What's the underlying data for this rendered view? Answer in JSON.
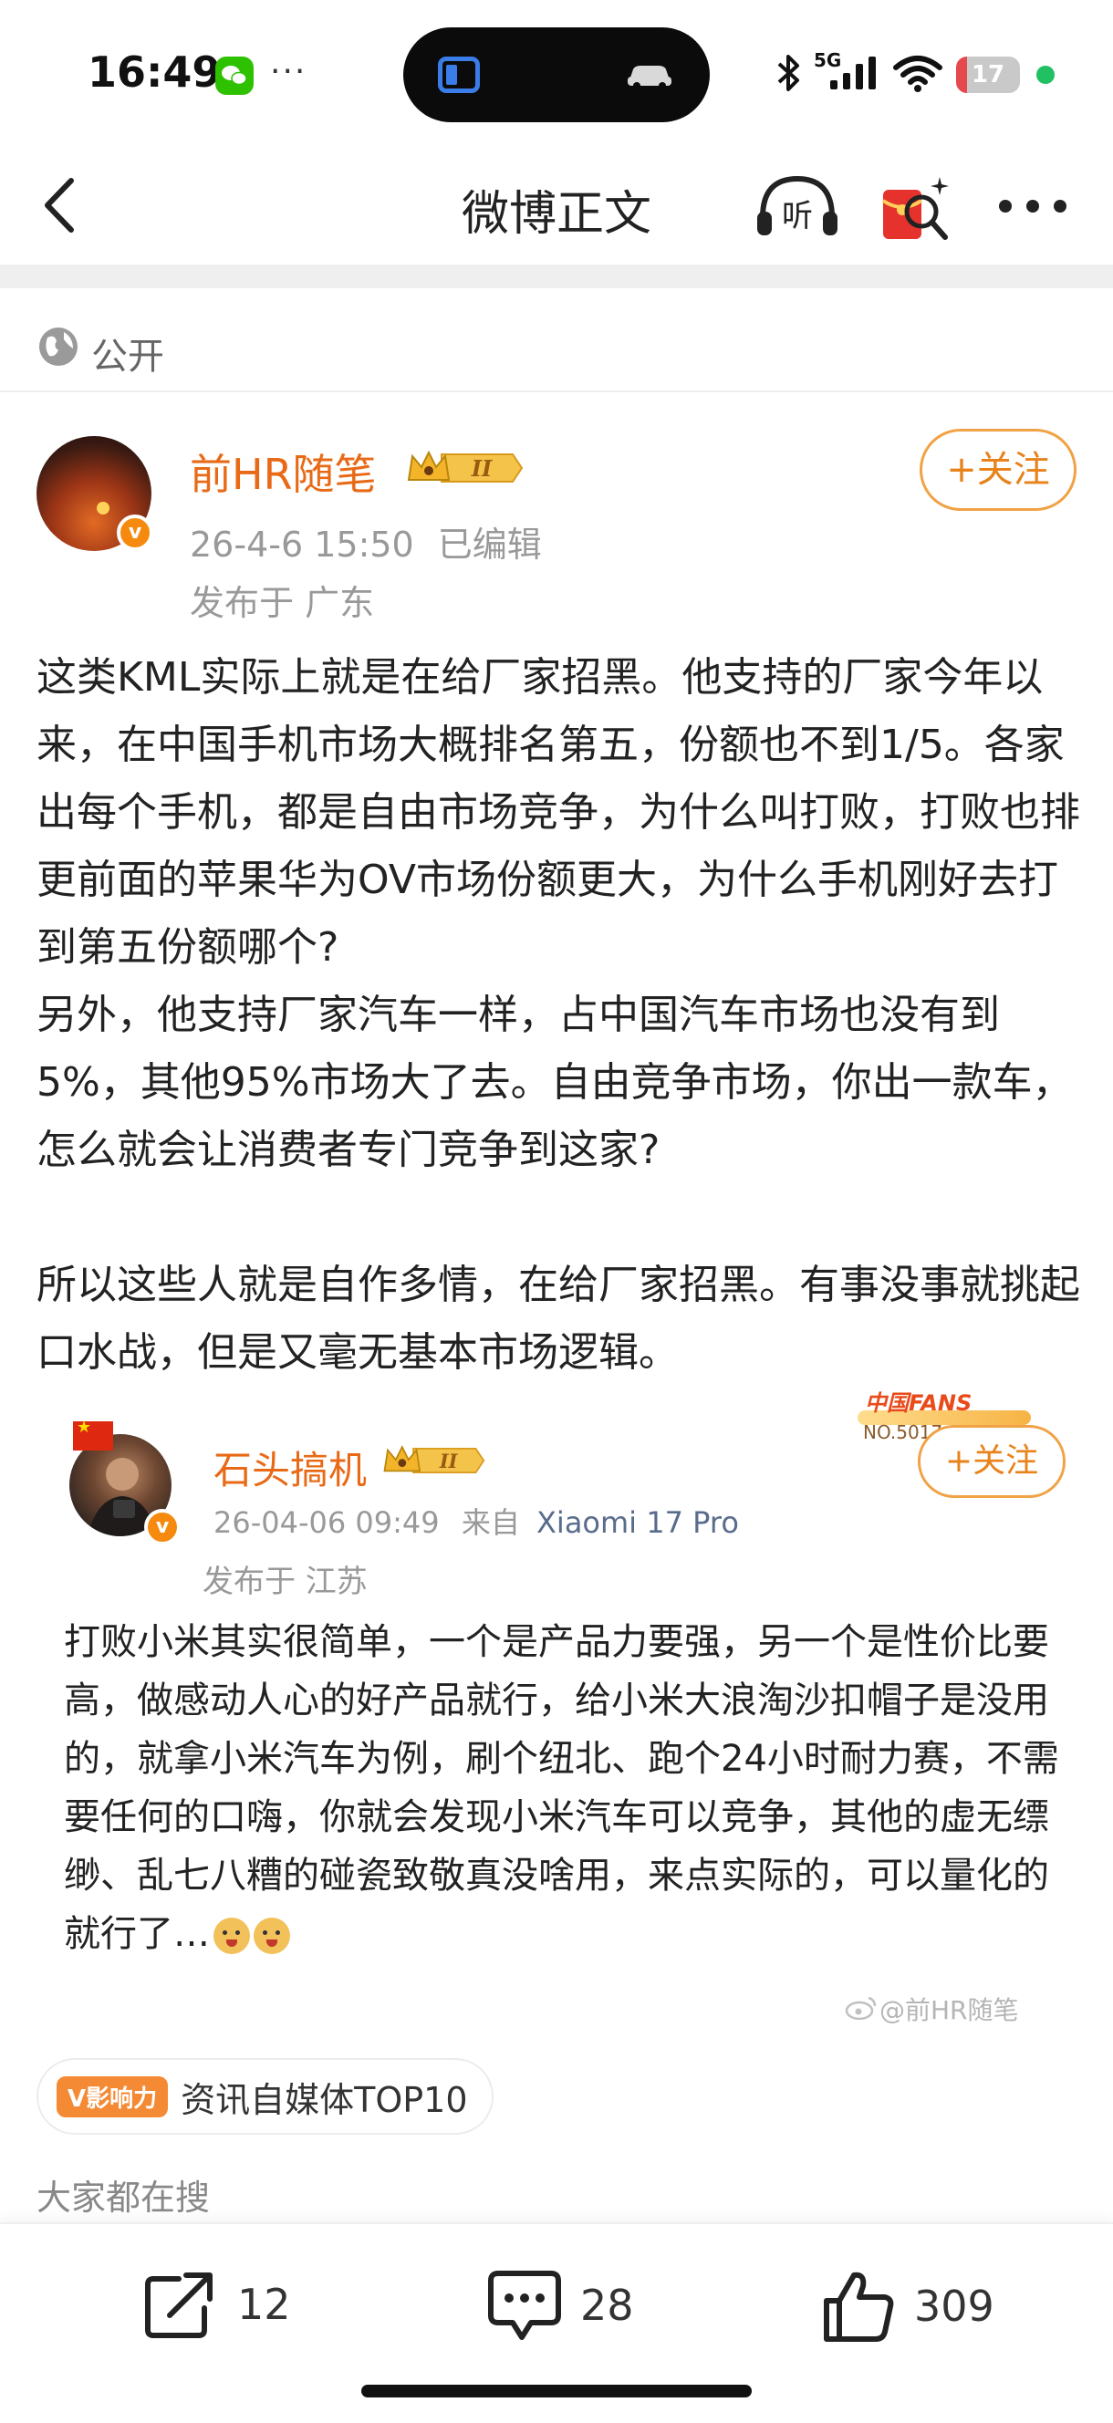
{
  "status_bar": {
    "time": "16:49",
    "more_dots": "···",
    "network": "5G",
    "battery": "17",
    "battery_level": 0.17,
    "colors": {
      "battery_low": "#e5484d",
      "active_dot": "#21c063",
      "wechat": "#2dc100"
    }
  },
  "nav": {
    "title": "微博正文",
    "listen_label": "听"
  },
  "visibility": {
    "label": "公开"
  },
  "author": {
    "name": "前HR随笔",
    "level_badge": "II",
    "timestamp": "26-4-6 15:50",
    "edited": "已编辑",
    "location": "发布于 广东",
    "follow_label": "+关注",
    "verified_mark": "v"
  },
  "post": {
    "paragraphs": [
      "这类KML实际上就是在给厂家招黑。他支持的厂家今年以来，在中国手机市场大概排名第五，份额也不到1/5。各家出每个手机，都是自由市场竞争，为什么叫打败，打败也排更前面的苹果华为OV市场份额更大，为什么手机刚好去打到第五份额哪个?",
      "另外，他支持厂家汽车一样，占中国汽车市场也没有到5%，其他95%市场大了去。自由竞争市场，你出一款车，怎么就会让消费者专门竞争到这家?",
      "所以这些人就是自作多情，在给厂家招黑。有事没事就挑起口水战，但是又毫无基本市场逻辑。"
    ]
  },
  "quoted": {
    "name": "石头搞机",
    "level_badge": "II",
    "timestamp": "26-04-06 09:49",
    "source_prefix": "来自",
    "source": "Xiaomi 17 Pro",
    "location": "发布于 江苏",
    "follow_label": "+关注",
    "fans_title": "中国FANS",
    "fans_no": "NO.5017",
    "verified_mark": "v",
    "body": "打败小米其实很简单，一个是产品力要强，另一个是性价比要高，做感动人心的好产品就行，给小米大浪淘沙扣帽子是没用的，就拿小米汽车为例，刷个纽北、跑个24小时耐力赛，不需要任何的口嗨，你就会发现小米汽车可以竞争，其他的虚无缥缈、乱七八糟的碰瓷致敬真没啥用，来点实际的，可以量化的就行了…"
  },
  "watermark": "@前HR随笔",
  "influence": {
    "badge": "V影响力",
    "text": "资讯自媒体TOP10"
  },
  "search_hint": "大家都在搜",
  "actions": {
    "repost_count": "12",
    "comment_count": "28",
    "like_count": "309"
  },
  "colors": {
    "accent_orange": "#e86a17",
    "follow_border": "#f0a245"
  }
}
